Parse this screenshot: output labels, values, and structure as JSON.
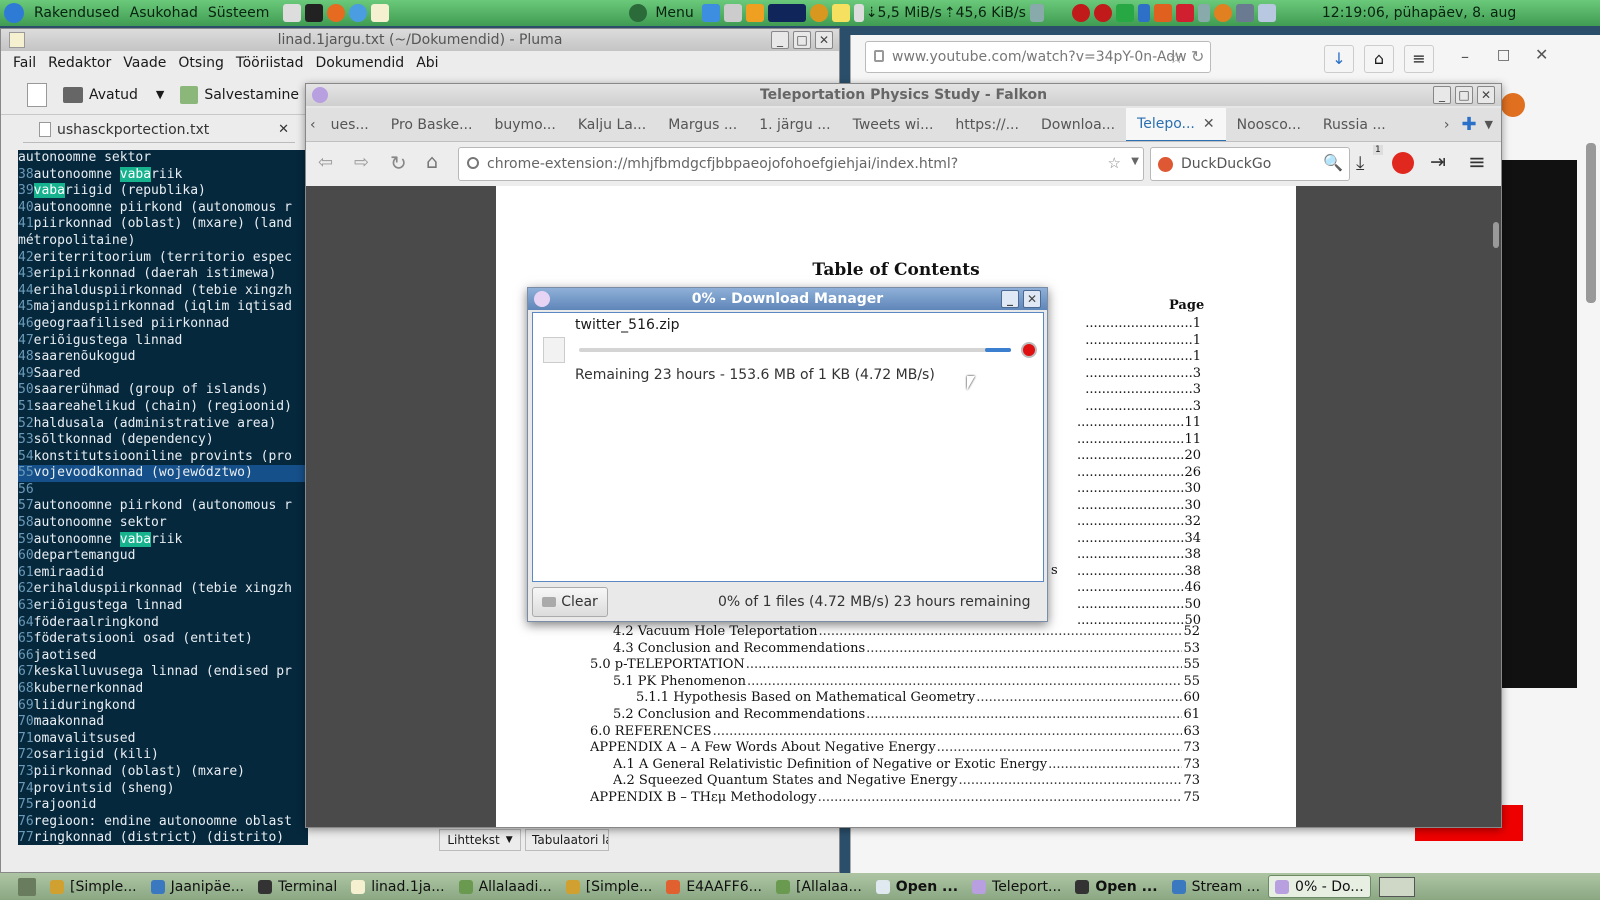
{
  "top_panel": {
    "menus": [
      "Rakendused",
      "Asukohad",
      "Süsteem"
    ],
    "menu_label": "Menu",
    "net_down": "5,5 MiB/s",
    "net_up": "45,6 KiB/s",
    "clock": "12:19:06, pühapäev,  8. aug"
  },
  "pluma": {
    "title": "linad.1jargu.txt (~/Dokumendid) - Pluma",
    "menu": [
      "Fail",
      "Redaktor",
      "Vaade",
      "Otsing",
      "Tööriistad",
      "Dokumendid",
      "Abi"
    ],
    "open_label": "Avatud",
    "save_label": "Salvestamine",
    "side_tab": "ushasckportection.txt",
    "lines": [
      {
        "n": "",
        "t": "autonoomne sektor"
      },
      {
        "n": "38",
        "t": "autonoomne ",
        "h": "vaba",
        "r": "riik"
      },
      {
        "n": "39",
        "t": "",
        "h": "vaba",
        "r": "riigid (republika)"
      },
      {
        "n": "40",
        "t": "autonoomne piirkond (autonomous r"
      },
      {
        "n": "41",
        "t": "piirkonnad (oblast) (mxare) (land"
      },
      {
        "n": "",
        "t": "métropolitaine)"
      },
      {
        "n": "42",
        "t": "eriterritoorium (territorio espec"
      },
      {
        "n": "43",
        "t": "eripiirkonnad (daerah istimewa)"
      },
      {
        "n": "44",
        "t": "erihalduspiirkonnad (tebie xingzh"
      },
      {
        "n": "45",
        "t": "majanduspiirkonnad (iqlim iqtisad"
      },
      {
        "n": "46",
        "t": "geograafilised piirkonnad"
      },
      {
        "n": "47",
        "t": "eriõigustega linnad"
      },
      {
        "n": "48",
        "t": "saarenõukogud"
      },
      {
        "n": "49",
        "t": "Saared"
      },
      {
        "n": "50",
        "t": "saarerühmad (group of islands)"
      },
      {
        "n": "51",
        "t": "saareahelikud (chain) (regioonid)"
      },
      {
        "n": "52",
        "t": "haldusala (administrative area)"
      },
      {
        "n": "53",
        "t": "sõltkonnad (dependency)"
      },
      {
        "n": "54",
        "t": "konstitutsiooniline provints (pro"
      },
      {
        "n": "55",
        "t": "vojevoodkonnad (województwo)",
        "cur": true
      },
      {
        "n": "56",
        "t": ""
      },
      {
        "n": "57",
        "t": "autonoomne piirkond (autonomous r"
      },
      {
        "n": "58",
        "t": "autonoomne sektor"
      },
      {
        "n": "59",
        "t": "autonoomne ",
        "h": "vaba",
        "r": "riik"
      },
      {
        "n": "60",
        "t": "departemangud"
      },
      {
        "n": "61",
        "t": "emiraadid"
      },
      {
        "n": "62",
        "t": "erihalduspiirkonnad (tebie xingzh"
      },
      {
        "n": "63",
        "t": "eriõigustega linnad"
      },
      {
        "n": "64",
        "t": "föderaalringkond"
      },
      {
        "n": "65",
        "t": "föderatsiooni osad (entitet)"
      },
      {
        "n": "66",
        "t": "jaotised"
      },
      {
        "n": "67",
        "t": "keskalluvusega linnad (endised pr"
      },
      {
        "n": "68",
        "t": "kubernerkonnad"
      },
      {
        "n": "69",
        "t": "liiduringkond"
      },
      {
        "n": "70",
        "t": "maakonnad"
      },
      {
        "n": "71",
        "t": "omavalitsused"
      },
      {
        "n": "72",
        "t": "osariigid (kili)"
      },
      {
        "n": "73",
        "t": "piirkonnad (oblast) (mxare)"
      },
      {
        "n": "74",
        "t": "provintsid (sheng)"
      },
      {
        "n": "75",
        "t": "rajoonid"
      },
      {
        "n": "76",
        "t": "regioon: endine autonoomne oblast"
      },
      {
        "n": "77",
        "t": "ringkonnad (district) (distrito)"
      }
    ],
    "status_syntax": "Lihttekst",
    "status_tab": "Tabulaatori la"
  },
  "youtube_window": {
    "url": "www.youtube.com/watch?v=34pY-0n-Adw"
  },
  "falkon": {
    "title": "Teleportation Physics Study - Falkon",
    "tabs": [
      "ues...",
      "Pro Baske...",
      "buymo...",
      "Kalju La...",
      "Margus ...",
      "1. järgu ...",
      "Tweets wi...",
      "https://...",
      "Downloa...",
      "Telepo...",
      "Noosco...",
      "Russia ..."
    ],
    "active_tab": 9,
    "url": "chrome-extension://mhjfbmdgcfjbbpaeojofohoefgiehjai/index.html?",
    "search_placeholder": "DuckDuckGo",
    "download_badge": "1",
    "toc_title": "Table of Contents",
    "toc_page_header": "Page",
    "page_numbers_top": [
      "1",
      "1",
      "1",
      "3",
      "3",
      "3",
      "11",
      "11",
      "20",
      "26",
      "30",
      "30",
      "32",
      "34",
      "38",
      "38",
      "46",
      "50",
      "50"
    ],
    "toc_partial": "s",
    "toc_entries": [
      {
        "level": 1,
        "text": "4.2 Vacuum Hole Teleportation",
        "page": "52"
      },
      {
        "level": 1,
        "text": "4.3 Conclusion and Recommendations",
        "page": "53"
      },
      {
        "level": 0,
        "text": "5.0  p-TELEPORTATION",
        "page": "55"
      },
      {
        "level": 1,
        "text": "5.1 PK Phenomenon",
        "page": "55"
      },
      {
        "level": 2,
        "text": "5.1.1 Hypothesis Based on Mathematical Geometry",
        "page": "60"
      },
      {
        "level": 1,
        "text": "5.2 Conclusion and Recommendations",
        "page": "61"
      },
      {
        "level": 0,
        "text": "6.0  REFERENCES",
        "page": "63"
      },
      {
        "level": 0,
        "text": "APPENDIX A – A Few Words About Negative Energy",
        "page": "73"
      },
      {
        "level": 1,
        "text": "A.1  A General Relativistic Definition of Negative or Exotic Energy",
        "page": "73"
      },
      {
        "level": 1,
        "text": "A.2  Squeezed Quantum States and Negative Energy",
        "page": "73"
      },
      {
        "level": 0,
        "text": "APPENDIX B – THεμ Methodology",
        "page": "75"
      }
    ]
  },
  "download_manager": {
    "title": "0% - Download Manager",
    "file_name": "twitter_516.zip",
    "progress": 0,
    "status": "Remaining 23 hours - 153.6 MB of 1 KB (4.72 MB/s)",
    "clear_label": "Clear",
    "summary": "0% of 1 files (4.72 MB/s) 23 hours remaining"
  },
  "taskbar": [
    {
      "label": "[Simple...",
      "bold": false
    },
    {
      "label": "Jaanipäe...",
      "bold": false
    },
    {
      "label": "Terminal",
      "bold": false
    },
    {
      "label": "linad.1ja...",
      "bold": false
    },
    {
      "label": "Allalaadi...",
      "bold": false
    },
    {
      "label": "[Simple...",
      "bold": false
    },
    {
      "label": "E4AAFF6...",
      "bold": false
    },
    {
      "label": "[Allalaa...",
      "bold": false
    },
    {
      "label": "Open ...",
      "bold": true
    },
    {
      "label": "Teleport...",
      "bold": false
    },
    {
      "label": "Open ...",
      "bold": true
    },
    {
      "label": "Stream ...",
      "bold": false
    },
    {
      "label": "0% - Do...",
      "bold": false,
      "active": true
    }
  ],
  "colors": {
    "panel_green": "#4caf5f",
    "editor_bg": "#06283d",
    "highlight": "#17b38f",
    "dlm_title": "#6f94c6",
    "stop_red": "#e01010"
  }
}
